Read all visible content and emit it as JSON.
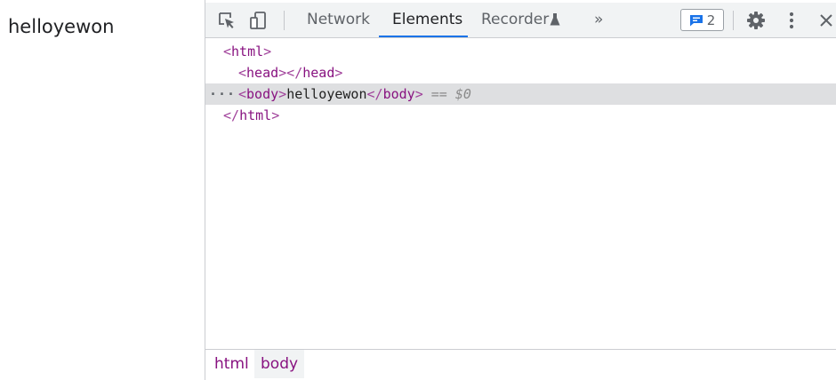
{
  "page": {
    "text": "helloyewon"
  },
  "toolbar": {
    "tabs": [
      {
        "label": "Network"
      },
      {
        "label": "Elements"
      },
      {
        "label": "Recorder"
      }
    ],
    "more_tabs_glyph": "»",
    "issues_count": "2",
    "icons": [
      "inspect-element-icon",
      "device-toolbar-icon",
      "flask-icon",
      "issues-icon",
      "gear-icon",
      "kebab-menu-icon",
      "close-icon"
    ],
    "accent_color": "#1a73e8"
  },
  "dom": {
    "lines": [
      {
        "open": "html"
      },
      {
        "open": "head",
        "close": "head"
      },
      {
        "open": "body",
        "text": "helloyewon",
        "close": "body",
        "hint": "== $0"
      },
      {
        "close": "html"
      }
    ],
    "tag_color": "#881280"
  },
  "breadcrumbs": [
    "html",
    "body"
  ]
}
